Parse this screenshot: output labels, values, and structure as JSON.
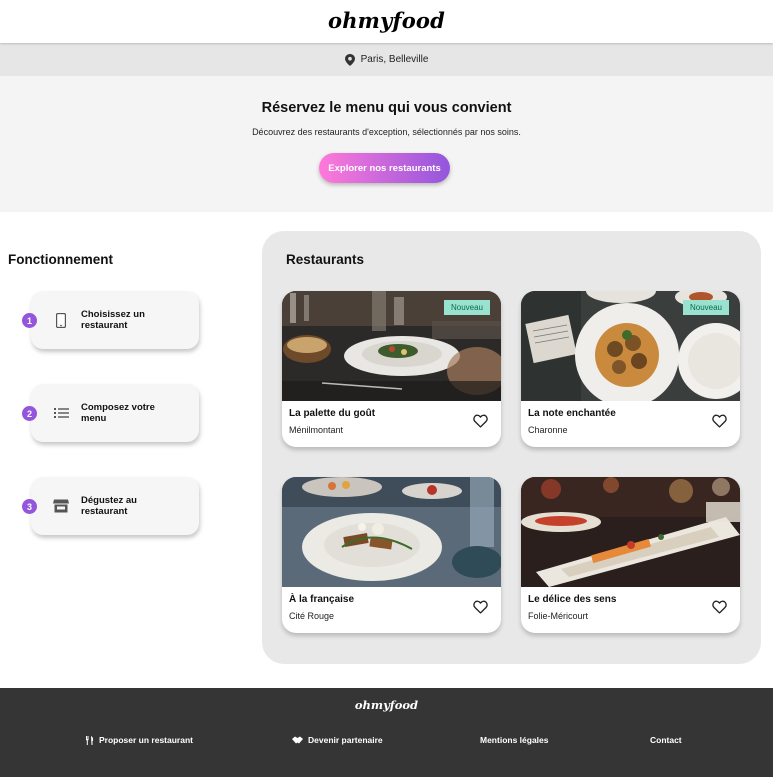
{
  "header": {
    "logo": "ohmyfood",
    "location": "Paris, Belleville"
  },
  "hero": {
    "title": "Réservez le menu qui vous convient",
    "subtitle": "Découvrez des restaurants d'exception, sélectionnés par nos soins.",
    "cta_label": "Explorer nos restaurants"
  },
  "fonctionnement": {
    "title": "Fonctionnement",
    "steps": [
      {
        "number": "1",
        "label": "Choisissez un restaurant",
        "icon": "mobile-phone-icon"
      },
      {
        "number": "2",
        "label": "Composez votre menu",
        "icon": "list-icon"
      },
      {
        "number": "3",
        "label": "Dégustez au restaurant",
        "icon": "store-icon"
      }
    ]
  },
  "restaurants": {
    "title": "Restaurants",
    "items": [
      {
        "name": "La palette du goût",
        "location": "Ménilmontant",
        "badge": "Nouveau"
      },
      {
        "name": "La note enchantée",
        "location": "Charonne",
        "badge": "Nouveau"
      },
      {
        "name": "À la française",
        "location": "Cité Rouge",
        "badge": ""
      },
      {
        "name": "Le délice des sens",
        "location": "Folie-Méricourt",
        "badge": ""
      }
    ]
  },
  "footer": {
    "logo": "ohmyfood",
    "links": [
      {
        "label": "Proposer un restaurant",
        "icon": "utensils-icon"
      },
      {
        "label": "Devenir partenaire",
        "icon": "handshake-icon"
      },
      {
        "label": "Mentions légales",
        "icon": ""
      },
      {
        "label": "Contact",
        "icon": ""
      }
    ]
  },
  "colors": {
    "accent_pink": "#ff79da",
    "accent_purple": "#9356dc",
    "badge_bg": "#99e2d0",
    "footer_bg": "#353535"
  }
}
